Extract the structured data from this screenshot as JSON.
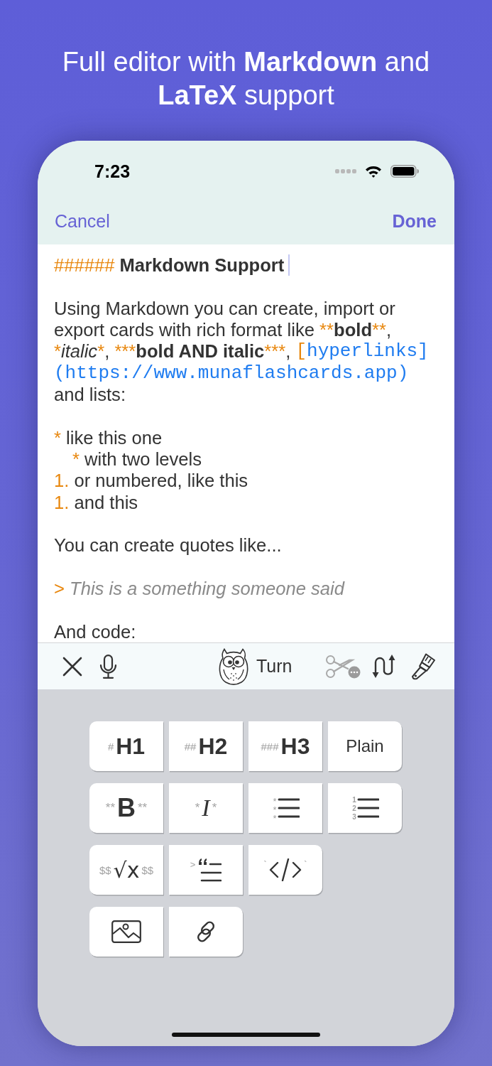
{
  "headline": "Full editor with **Markdown** and **LaTeX** support",
  "status_bar": {
    "time": "7:23"
  },
  "nav_bar": {
    "cancel": "Cancel",
    "done": "Done"
  },
  "editor": {
    "blocks": [
      {
        "lines": [
          {
            "cursor": true,
            "segments": [
              {
                "kind": "marker",
                "text": "######"
              },
              {
                "kind": "heading",
                "text": " Markdown Support"
              }
            ]
          }
        ]
      },
      {
        "lines": [
          {
            "cursor": false,
            "segments": [
              {
                "kind": "plain",
                "text": "Using Markdown you can create, import or"
              }
            ]
          },
          {
            "cursor": false,
            "segments": [
              {
                "kind": "plain",
                "text": "export cards with rich format like "
              },
              {
                "kind": "marker",
                "text": "**"
              },
              {
                "kind": "bold",
                "text": "bold"
              },
              {
                "kind": "marker",
                "text": "**"
              },
              {
                "kind": "plain",
                "text": ","
              }
            ]
          },
          {
            "cursor": false,
            "segments": [
              {
                "kind": "marker",
                "text": "*"
              },
              {
                "kind": "italic",
                "text": "italic"
              },
              {
                "kind": "marker",
                "text": "*"
              },
              {
                "kind": "plain",
                "text": ", "
              },
              {
                "kind": "marker",
                "text": "***"
              },
              {
                "kind": "bold",
                "text": "bold AND italic"
              },
              {
                "kind": "marker",
                "text": "***"
              },
              {
                "kind": "plain",
                "text": ", "
              },
              {
                "kind": "mono_marker",
                "text": "["
              },
              {
                "kind": "link",
                "text": "hyperlinks]"
              }
            ]
          },
          {
            "cursor": false,
            "segments": [
              {
                "kind": "link",
                "text": "(https://www.munaflashcards.app)"
              }
            ]
          },
          {
            "cursor": false,
            "segments": [
              {
                "kind": "plain",
                "text": "and lists:"
              }
            ]
          }
        ]
      },
      {
        "lines": [
          {
            "cursor": false,
            "segments": [
              {
                "kind": "marker",
                "text": "*"
              },
              {
                "kind": "plain",
                "text": " like this one"
              }
            ],
            "children": [
              {
                "cursor": false,
                "segments": [
                  {
                    "kind": "marker",
                    "text": "*"
                  },
                  {
                    "kind": "plain",
                    "text": " with two levels"
                  }
                ]
              }
            ]
          },
          {
            "cursor": false,
            "segments": [
              {
                "kind": "marker",
                "text": "1."
              },
              {
                "kind": "plain",
                "text": " or numbered, like this"
              }
            ]
          },
          {
            "cursor": false,
            "segments": [
              {
                "kind": "marker",
                "text": "1."
              },
              {
                "kind": "plain",
                "text": " and this"
              }
            ]
          }
        ]
      },
      {
        "lines": [
          {
            "cursor": false,
            "segments": [
              {
                "kind": "plain",
                "text": "You can create quotes like..."
              }
            ]
          }
        ]
      },
      {
        "lines": [
          {
            "cursor": false,
            "segments": [
              {
                "kind": "marker",
                "text": ">"
              },
              {
                "kind": "quote",
                "text": " This is a something someone said"
              }
            ]
          }
        ]
      },
      {
        "lines": [
          {
            "cursor": false,
            "segments": [
              {
                "kind": "plain",
                "text": "And code:"
              }
            ]
          }
        ]
      }
    ]
  },
  "toolbar": {
    "turn_button": {
      "label": "Turn"
    },
    "cut_button": {
      "disabled": true
    }
  },
  "format_keys": {
    "rows": [
      {
        "keys": [
          {
            "kind": "heading",
            "prefix": "#",
            "label": "H1"
          },
          {
            "kind": "heading",
            "prefix": "##",
            "label": "H2"
          },
          {
            "kind": "heading",
            "prefix": "###",
            "label": "H3"
          },
          {
            "kind": "plain",
            "label": "Plain"
          }
        ]
      },
      {
        "keys": [
          {
            "kind": "bold",
            "prefix": "**",
            "label": "B",
            "suffix": "**"
          },
          {
            "kind": "italic",
            "prefix": "*",
            "label": "I",
            "suffix": "*"
          },
          {
            "kind": "bullet_list",
            "markers": [
              "*",
              "*",
              "*"
            ]
          },
          {
            "kind": "numbered_list",
            "markers": [
              "1",
              "2",
              "3"
            ]
          }
        ]
      },
      {
        "keys": [
          {
            "kind": "math",
            "prefix": "$$",
            "label": "√x",
            "suffix": "$$"
          },
          {
            "kind": "quote",
            "prefix": ">"
          },
          {
            "kind": "code",
            "prefix": "`",
            "suffix": "`"
          }
        ]
      },
      {
        "keys": [
          {
            "kind": "image"
          },
          {
            "kind": "link"
          }
        ]
      }
    ]
  }
}
